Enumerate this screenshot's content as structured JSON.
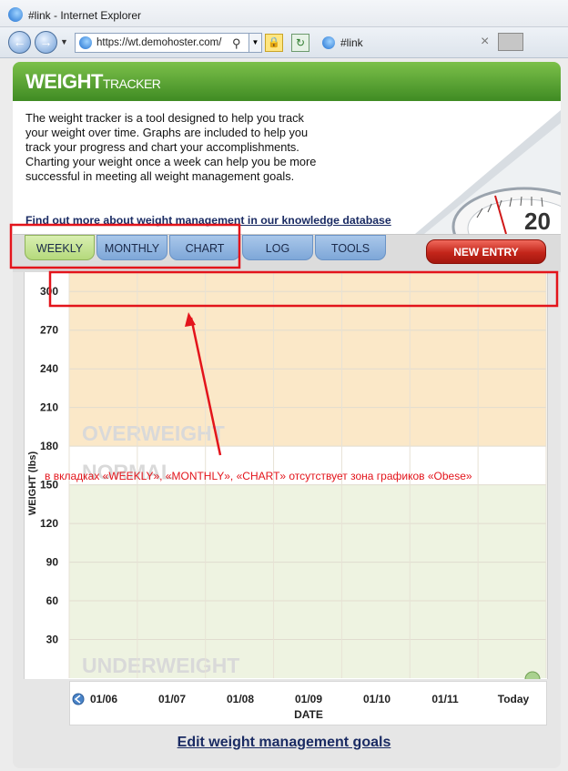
{
  "browser": {
    "window_title": "#link - Internet Explorer",
    "url": "https://wt.demohoster.com/",
    "tab_title": "#link"
  },
  "header": {
    "logo_bold": "WEIGHT",
    "logo_light": "TRACKER"
  },
  "intro": {
    "description": "The weight tracker is a tool designed to help you track your weight over time. Graphs are included to help you track your progress and chart your accomplishments. Charting your weight once a week can help you be more successful in meeting all weight management goals.",
    "knowledge_link": "Find out more about weight management in our knowledge database",
    "scale_number": "20"
  },
  "tabs": {
    "weekly": "WEEKLY",
    "monthly": "MONTHLY",
    "chart": "CHART",
    "log": "LOG",
    "tools": "TOOLS",
    "active": "weekly"
  },
  "new_entry_label": "NEW ENTRY",
  "edit_goals_label": "Edit weight management goals",
  "annotation": {
    "text": "в вкладках «WEEKLY», «MONTHLY», «CHART» отсутствует зона графиков «Obese»",
    "color": "#e3141b"
  },
  "colors": {
    "overweight_zone": "#fbe8c8",
    "normal_zone": "#ffffff",
    "underweight_zone": "#eef3e1",
    "zone_label": "#d9d9d9",
    "header_green": "#5aa433",
    "tab_blue": "#8fb4e0",
    "tab_active": "#c6e394"
  },
  "chart_data": {
    "type": "line",
    "xlabel": "DATE",
    "ylabel": "WEIGHT (lbs)",
    "categories": [
      "01/06",
      "01/07",
      "01/08",
      "01/09",
      "01/10",
      "01/11",
      "Today"
    ],
    "y_ticks": [
      30,
      60,
      90,
      120,
      150,
      180,
      210,
      240,
      270,
      300
    ],
    "ylim": [
      0,
      315
    ],
    "zones": [
      {
        "label": "OVERWEIGHT",
        "from": 180,
        "to": 315
      },
      {
        "label": "NORMAL",
        "from": 150,
        "to": 180
      },
      {
        "label": "UNDERWEIGHT",
        "from": 0,
        "to": 150
      }
    ],
    "series": [],
    "grid": true
  }
}
